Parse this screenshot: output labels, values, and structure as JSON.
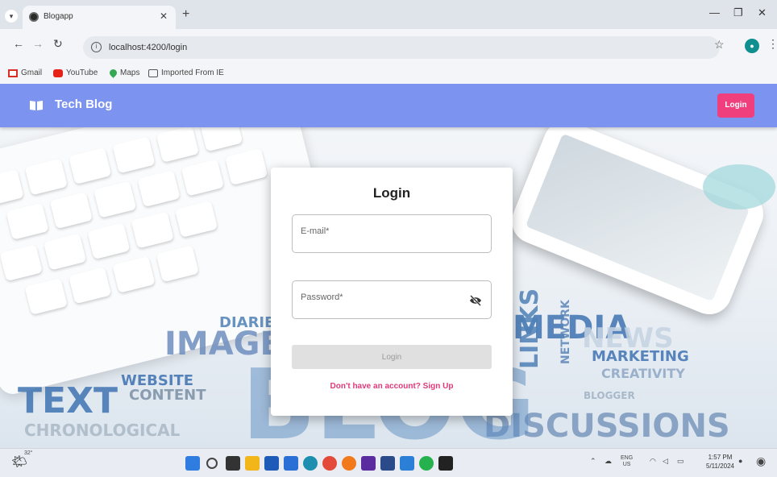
{
  "browser": {
    "tab_title": "Blogapp",
    "url": "localhost:4200/login",
    "bookmarks": [
      "Gmail",
      "YouTube",
      "Maps",
      "Imported From IE"
    ]
  },
  "app": {
    "title": "Tech Blog",
    "header_login_label": "Login"
  },
  "login_card": {
    "title": "Login",
    "email_placeholder": "E-mail*",
    "password_placeholder": "Password*",
    "submit_label": "Login",
    "signup_text": "Don't have an account? Sign Up"
  },
  "background_words": [
    "DIARIES",
    "IMAGE",
    "WEBSITE",
    "CONTENT",
    "TEXT",
    "CHRONOLOGICAL",
    "MEDIA",
    "LINKS",
    "NETWORK",
    "NEWS",
    "MARKETING",
    "CREATIVITY",
    "BLOGGER",
    "DISCUSSIONS",
    "BLOG"
  ],
  "taskbar": {
    "temperature": "32°",
    "lang": "ENG",
    "region": "US",
    "time": "1:57 PM",
    "date": "5/11/2024"
  },
  "colors": {
    "header": "#7c93f0",
    "accent": "#ef3f7d"
  }
}
